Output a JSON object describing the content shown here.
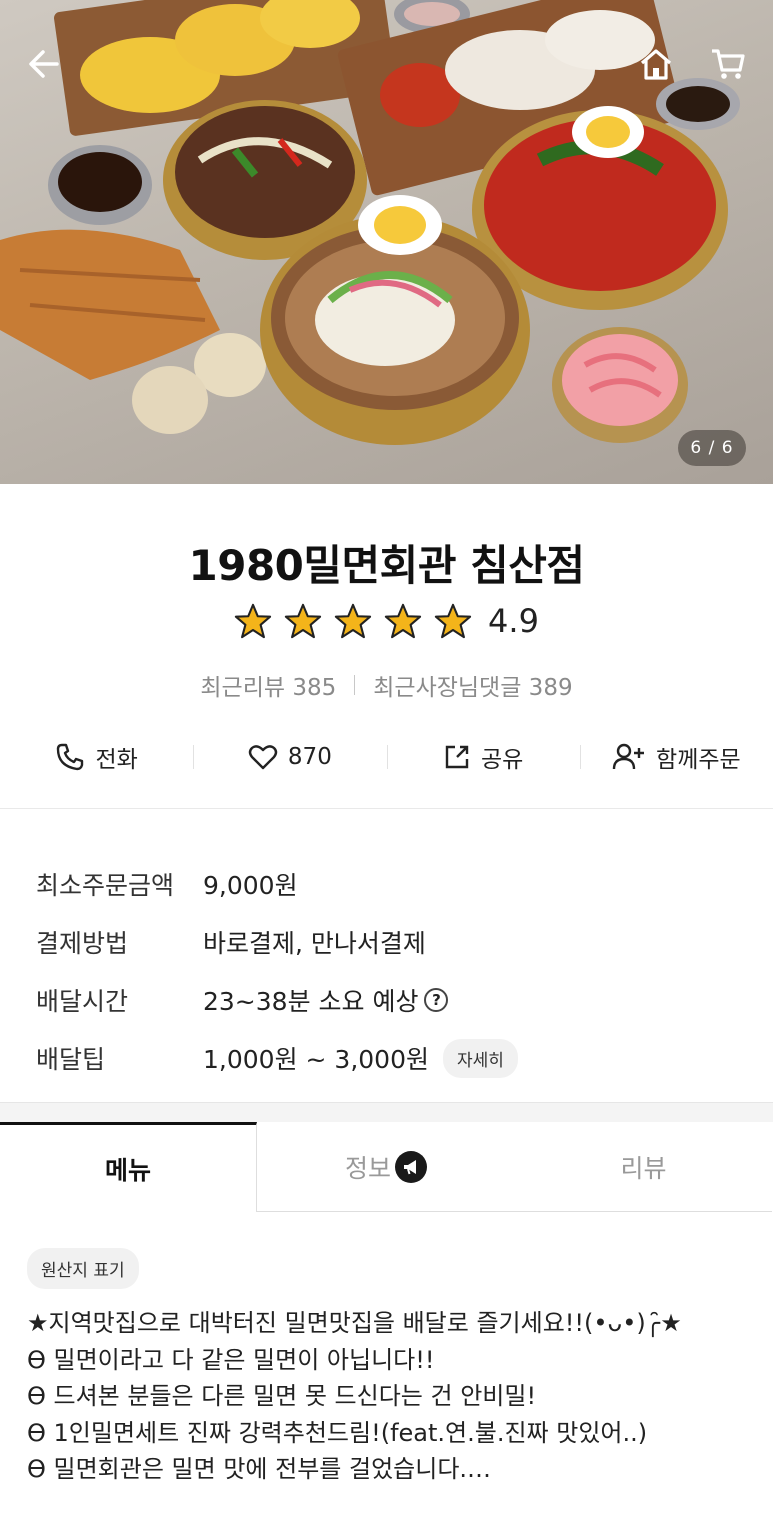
{
  "hero": {
    "image_counter": "6 / 6",
    "icons": [
      "back-arrow-icon",
      "home-icon",
      "cart-icon"
    ]
  },
  "store": {
    "name": "1980밀면회관 침산점",
    "rating": "4.9",
    "stars": 5,
    "recent_reviews": "최근리뷰 385",
    "owner_replies": "최근사장님댓글 389"
  },
  "actions": {
    "call": "전화",
    "likes": "870",
    "share": "공유",
    "group_order": "함께주문"
  },
  "info": {
    "min_order_label": "최소주문금액",
    "min_order_value": "9,000원",
    "payment_label": "결제방법",
    "payment_value": "바로결제, 만나서결제",
    "delivery_time_label": "배달시간",
    "delivery_time_value": "23~38분 소요 예상",
    "delivery_tip_label": "배달팁",
    "delivery_tip_value": "1,000원 ~ 3,000원",
    "detail_button": "자세히",
    "help_glyph": "?"
  },
  "tabs": {
    "menu": "메뉴",
    "info": "정보",
    "review": "리뷰"
  },
  "origin_chip": "원산지 표기",
  "description": [
    "★지역맛집으로 대박터진 밀면맛집을 배달로 즐기세요!!(•ᴗ•)╭̑★",
    "ϴ 밀면이라고 다 같은 밀면이 아닙니다!!",
    "ϴ 드셔본 분들은 다른 밀면 못 드신다는 건 안비밀!",
    "ϴ 1인밀면세트 진짜 강력추천드림!(feat.연.불.진짜 맛있어..)",
    "ϴ 밀면회관은 밀면 맛에 전부를 걸었습니다.…"
  ],
  "colors": {
    "star": "#f4b41a",
    "text": "#111111",
    "muted": "#8a8a8a"
  }
}
